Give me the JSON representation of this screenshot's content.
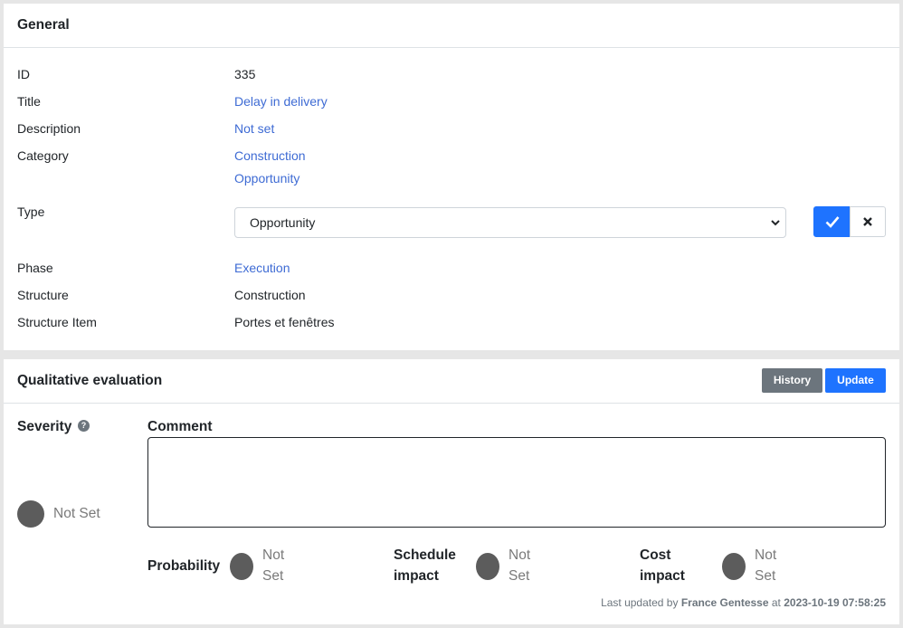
{
  "general": {
    "title": "General",
    "fields": {
      "id_label": "ID",
      "id_value": "335",
      "title_label": "Title",
      "title_value": "Delay in delivery",
      "description_label": "Description",
      "description_value": "Not set",
      "category_label": "Category",
      "category_value_1": "Construction",
      "category_value_2": "Opportunity",
      "type_label": "Type",
      "type_value": "Opportunity",
      "phase_label": "Phase",
      "phase_value": "Execution",
      "structure_label": "Structure",
      "structure_value": "Construction",
      "structure_item_label": "Structure Item",
      "structure_item_value": "Portes et fenêtres"
    }
  },
  "qualitative": {
    "title": "Qualitative evaluation",
    "history_label": "History",
    "update_label": "Update",
    "severity_label": "Severity",
    "severity_value": "Not Set",
    "comment_label": "Comment",
    "comment_value": "",
    "probability_label": "Probability",
    "probability_value_line1": "Not",
    "probability_value_line2": "Set",
    "schedule_label_line1": "Schedule",
    "schedule_label_line2": "impact",
    "schedule_value_line1": "Not",
    "schedule_value_line2": "Set",
    "cost_label_line1": "Cost",
    "cost_label_line2": "impact",
    "cost_value_line1": "Not",
    "cost_value_line2": "Set",
    "footer_prefix": "Last updated by",
    "footer_user": "France Gentesse",
    "footer_at": "at",
    "footer_timestamp": "2023-10-19 07:58:25"
  },
  "colors": {
    "primary": "#1e73ff",
    "secondary": "#6c757d",
    "link": "#3e6bd4",
    "dot": "#5c5c5c"
  },
  "icons": {
    "confirm": "check-icon",
    "cancel": "close-icon",
    "help": "question-circle-icon",
    "select": "chevron-down-icon"
  }
}
